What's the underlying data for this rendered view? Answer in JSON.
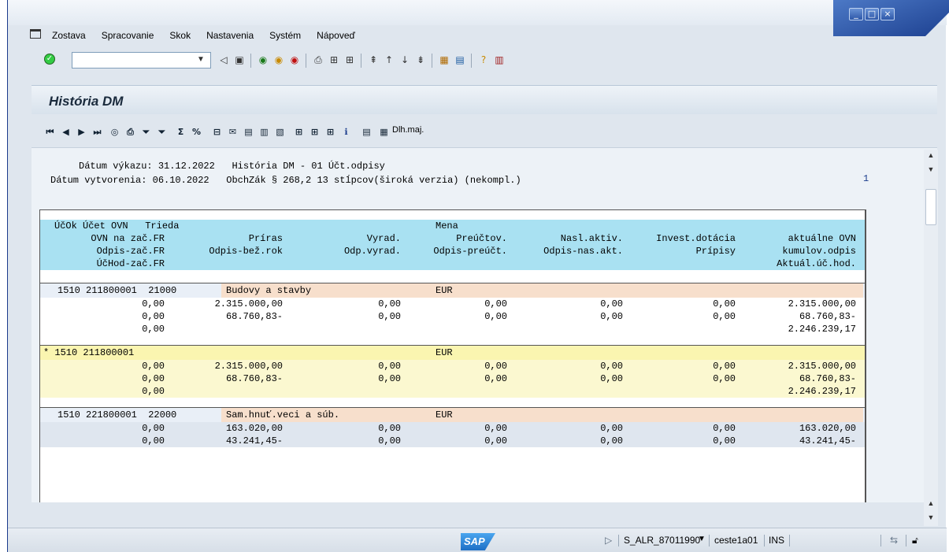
{
  "menu": [
    "Zostava",
    "Spracovanie",
    "Skok",
    "Nastavenia",
    "Systém",
    "Nápoveď"
  ],
  "window_controls": {
    "minimize": "_",
    "maximize": "□",
    "close": "×"
  },
  "command_field": {
    "value": ""
  },
  "title": "História DM",
  "toolbar2": {
    "extra_label": "Dlh.maj."
  },
  "header_info": {
    "line1": "     Dátum výkazu: 31.12.2022   História DM - 01 Účt.odpisy",
    "line2": "Dátum vytvorenia: 06.10.2022   ObchZák § 268,2 13 stĺpcov(široká verzia) (nekompl.)",
    "page": "1"
  },
  "columns_header": {
    "row1": {
      "c1": "ÚčOk Účet OVN   Trieda",
      "c2": "Mena"
    },
    "row2": [
      "OVN na zač.FR",
      "Príras",
      "Vyrad.",
      "Preúčtov.",
      "Nasl.aktiv.",
      "Invest.dotácia",
      "aktuálne OVN"
    ],
    "row3": [
      "Odpis-zač.FR",
      "Odpis-bež.rok",
      "Odp.vyrad.",
      "Odpis-preúčt.",
      "Odpis-nas.akt.",
      "Prípisy",
      "kumulov.odpis"
    ],
    "row4_first": "ÚčHod-zač.FR",
    "row4_last": "Aktuál.úč.hod."
  },
  "groups": [
    {
      "head": {
        "id": "1510 211800001  21000",
        "desc": "Budovy a stavby",
        "cur": "EUR"
      },
      "r1": [
        "0,00",
        "2.315.000,00",
        "0,00",
        "0,00",
        "0,00",
        "0,00",
        "2.315.000,00"
      ],
      "r2": [
        "0,00",
        "68.760,83-",
        "0,00",
        "0,00",
        "0,00",
        "0,00",
        "68.760,83-"
      ],
      "r3": {
        "first": "0,00",
        "last": "2.246.239,17"
      }
    },
    {
      "head": {
        "id": "* 1510 211800001",
        "desc": "",
        "cur": "EUR"
      },
      "r1": [
        "0,00",
        "2.315.000,00",
        "0,00",
        "0,00",
        "0,00",
        "0,00",
        "2.315.000,00"
      ],
      "r2": [
        "0,00",
        "68.760,83-",
        "0,00",
        "0,00",
        "0,00",
        "0,00",
        "68.760,83-"
      ],
      "r3": {
        "first": "0,00",
        "last": "2.246.239,17"
      }
    },
    {
      "head": {
        "id": "1510 221800001  22000",
        "desc": "Sam.hnuť.veci a súb.",
        "cur": "EUR"
      },
      "r1": [
        "0,00",
        "163.020,00",
        "0,00",
        "0,00",
        "0,00",
        "0,00",
        "163.020,00"
      ],
      "r2": [
        "0,00",
        "43.241,45-",
        "0,00",
        "0,00",
        "0,00",
        "0,00",
        "43.241,45-"
      ]
    }
  ],
  "status": {
    "logo": "SAP",
    "transaction": "S_ALR_87011990",
    "user": "ceste1a01",
    "mode": "INS"
  }
}
